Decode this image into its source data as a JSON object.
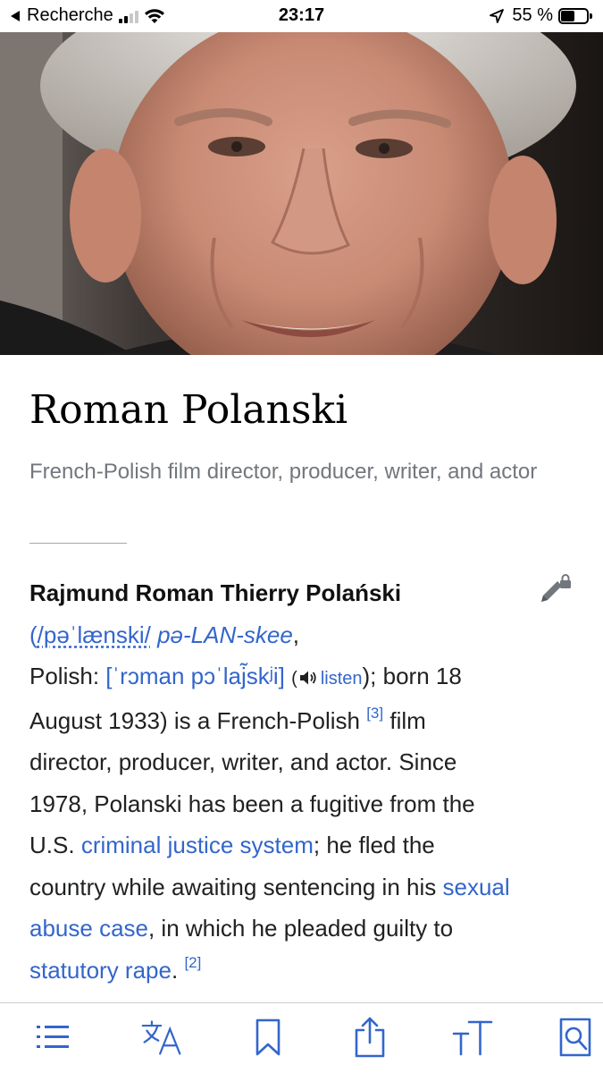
{
  "status_bar": {
    "back_label": "Recherche",
    "time": "23:17",
    "battery_text": "55 %",
    "battery_level": 0.55
  },
  "lead_image": {
    "icon": "portrait-photo"
  },
  "article": {
    "title": "Roman Polanski",
    "description": "French-Polish film director, producer, writer, and actor",
    "edit_icon": "edit-pencil-lock-icon",
    "paragraph": {
      "name_bold": "Rajmund Roman Thierry Polański",
      "paren_open": "(",
      "ipa_english": "/pəˈlænski/",
      "respelling": "pə-LAN-skee",
      "comma": ",",
      "polish_label": "Polish:",
      "ipa_polish": "[ˈrɔman pɔˈlaj͂skʲi]",
      "listen_open": "(",
      "listen_label": "listen",
      "listen_close_text": "); born 18",
      "born_rest": "August 1933) is a French-Polish",
      "ref_3": "[3]",
      "text_film": "film",
      "line4": "director, producer, writer, and actor. Since",
      "line5": "1978, Polanski has been a fugitive from the",
      "line6_prefix": "U.S.",
      "link_cjs": "criminal justice system",
      "line6_suffix": "; he fled the",
      "line7_prefix": "country while awaiting sentencing in his",
      "link_sexual": "sexual",
      "link_abuse_case": "abuse case",
      "line8_suffix": ", in which he pleaded guilty to",
      "link_statutory": "statutory rape",
      "period": ".",
      "ref_2": "[2]"
    }
  },
  "toolbar": {
    "items": [
      {
        "icon": "table-of-contents-icon"
      },
      {
        "icon": "language-icon"
      },
      {
        "icon": "bookmark-icon"
      },
      {
        "icon": "share-icon"
      },
      {
        "icon": "text-size-icon"
      },
      {
        "icon": "find-in-page-icon"
      }
    ],
    "accent_color": "#3366cc"
  },
  "colors": {
    "link": "#3366cc",
    "description": "#72777d",
    "text": "#202122"
  }
}
